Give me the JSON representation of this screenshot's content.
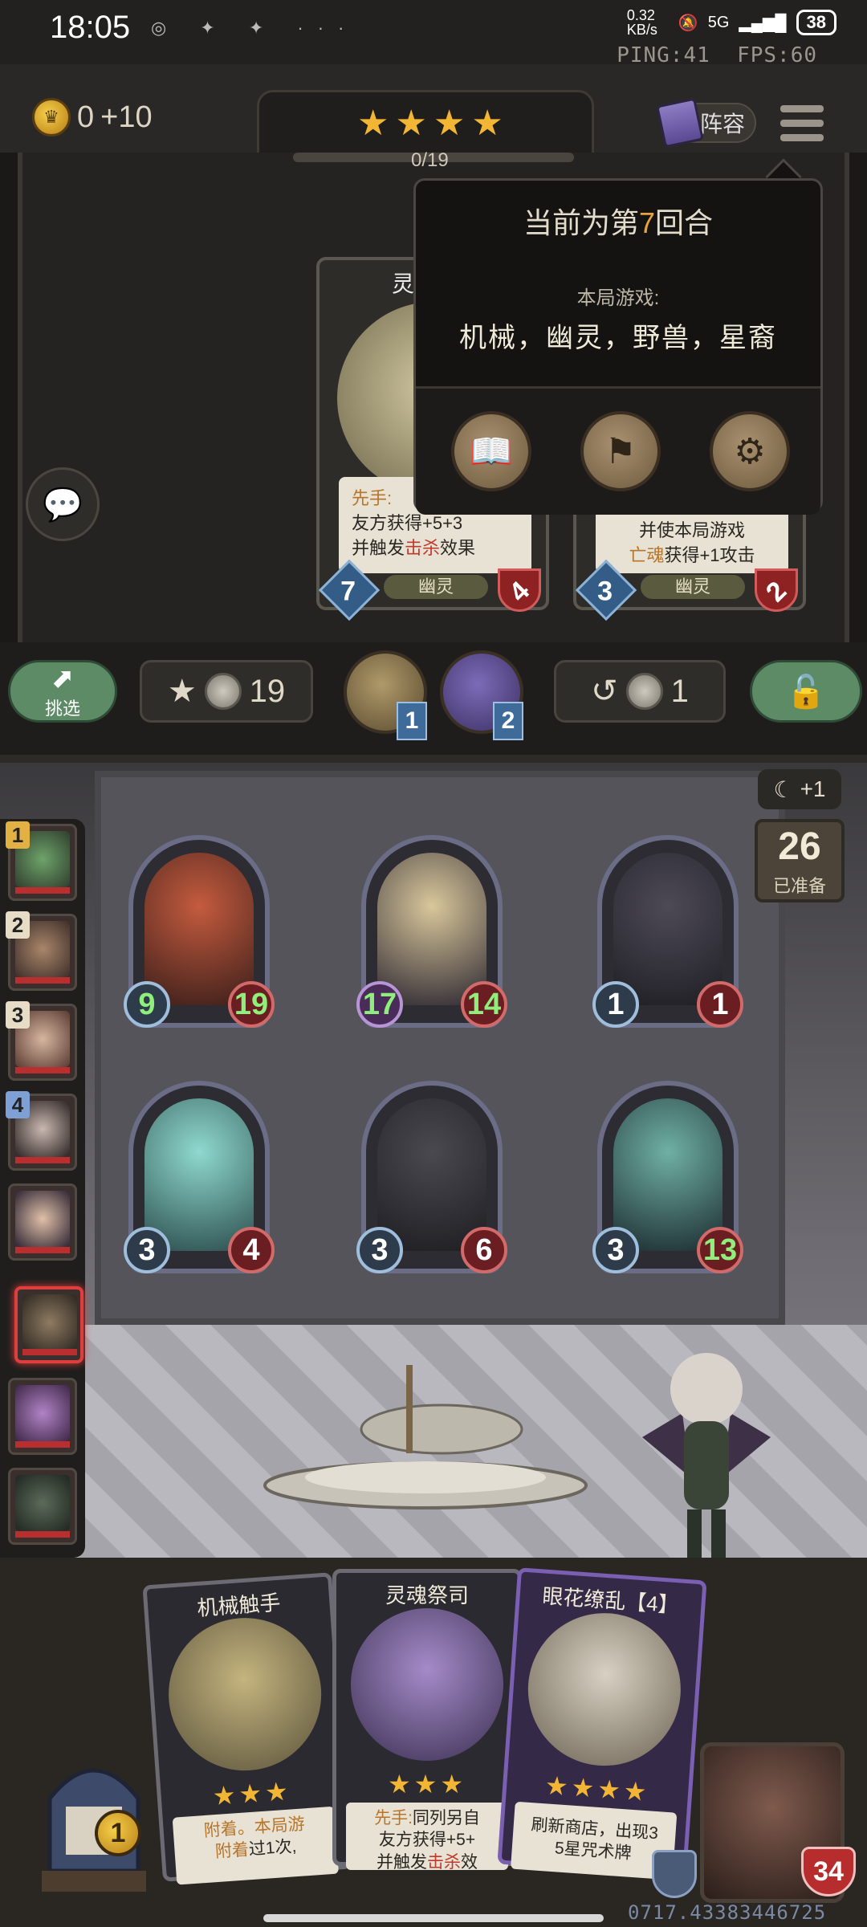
{
  "status_bar": {
    "time": "18:05",
    "notification_icons": "◎ ✦ ✦ ···",
    "network_speed": "0.32 KB/s",
    "signal": "5G",
    "battery": "38",
    "ping": "PING:41",
    "fps": "FPS:60"
  },
  "top": {
    "gold": "0",
    "gold_income": "+10",
    "tier_stars": "★★★★",
    "progress": "0/19",
    "lineup_label": "阵容"
  },
  "popup": {
    "round_prefix": "当前为第",
    "round_number": "7",
    "round_suffix": "回合",
    "subtitle": "本局游戏:",
    "tribes": "机械，幽灵，野兽，星裔",
    "buttons": [
      "book-icon",
      "shop-cart-icon",
      "gear-icon"
    ]
  },
  "shop_cards": [
    {
      "name": "灵",
      "desc_line1_prefix": "先手:",
      "desc_line2": "友方获得+5+3",
      "desc_line3_prefix": "并触发",
      "desc_line3_keyword": "击杀",
      "desc_line3_suffix": "效果",
      "tribe": "幽灵",
      "attack": "7",
      "health": "4"
    },
    {
      "desc_line1": "并使本局游戏",
      "desc_line2_keyword": "亡魂",
      "desc_line2_suffix": "获得+1攻击",
      "tribe": "幽灵",
      "attack": "3",
      "health": "2"
    }
  ],
  "action_bar": {
    "pick_label": "挑选",
    "upgrade_cost": "19",
    "orb1_count": "1",
    "orb2_count": "2",
    "refresh_cost": "1"
  },
  "board": {
    "minions": [
      {
        "attack": "9",
        "health": "19"
      },
      {
        "attack": "17",
        "health": "14"
      },
      {
        "attack": "1",
        "health": "1"
      },
      {
        "attack": "3",
        "health": "4"
      },
      {
        "attack": "3",
        "health": "6"
      },
      {
        "attack": "3",
        "health": "13"
      }
    ],
    "moon_bonus": "+1",
    "ready_count": "26",
    "ready_label": "已准备"
  },
  "roster": {
    "ranks": [
      "1",
      "2",
      "3",
      "4"
    ]
  },
  "hand": [
    {
      "title": "机械触手",
      "stars": "★★★",
      "desc_a": "附着。本局游",
      "desc_b_keyword": "附着",
      "desc_b_suffix": "过1次,"
    },
    {
      "title": "灵魂祭司",
      "stars": "★★★",
      "desc_a_prefix": "先手:",
      "desc_a_suffix": "同列另自",
      "desc_b": "友方获得+5+",
      "desc_c_prefix": "并触发",
      "desc_c_keyword": "击杀",
      "desc_c_suffix": "效"
    },
    {
      "title": "眼花缭乱【4】",
      "stars": "★★★★",
      "desc_a": "刷新商店，出现3",
      "desc_b": "5星咒术牌"
    }
  ],
  "footer": {
    "shop_coin": "1",
    "hero_health": "34",
    "coords": "0717.43383446725"
  }
}
